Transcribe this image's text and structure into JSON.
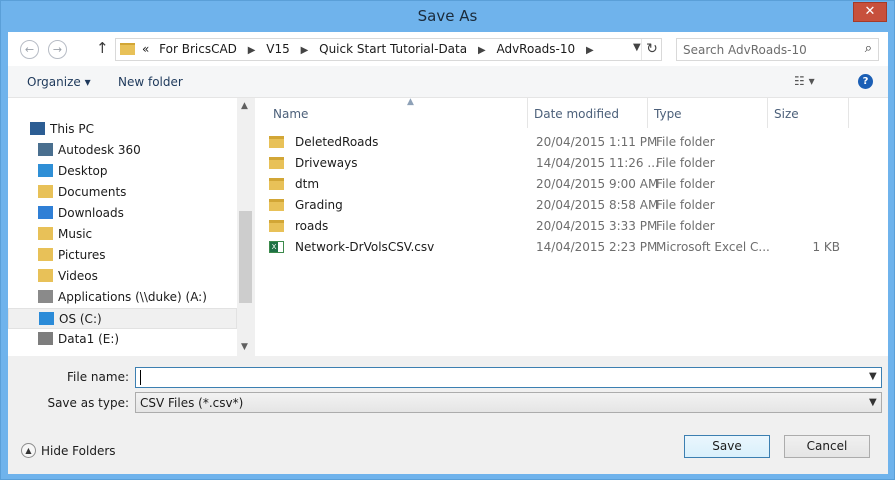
{
  "window": {
    "title": "Save As",
    "close_glyph": "✕"
  },
  "nav": {
    "back_glyph": "←",
    "forward_glyph": "→",
    "up_glyph": "↑",
    "address_prefix": "«",
    "crumbs": [
      "For BricsCAD",
      "V15",
      "Quick Start Tutorial-Data",
      "AdvRoads-10"
    ],
    "crumb_separator": "▶",
    "dropdown_glyph": "▼",
    "refresh_glyph": "↻",
    "search_placeholder": "Search AdvRoads-10",
    "search_glyph": "⌕"
  },
  "toolbar": {
    "organize_label": "Organize ▾",
    "new_folder_label": "New folder",
    "views_glyph": "☷ ▾",
    "help_glyph": "?"
  },
  "tree": [
    {
      "label": "This PC",
      "icon": "computer-icon",
      "color": "#2c5d93"
    },
    {
      "label": "Autodesk 360",
      "icon": "cloud-icon",
      "color": "#4a6f8f"
    },
    {
      "label": "Desktop",
      "icon": "desktop-folder-icon",
      "color": "#2f8fd6"
    },
    {
      "label": "Documents",
      "icon": "documents-folder-icon",
      "color": "#e8c158"
    },
    {
      "label": "Downloads",
      "icon": "downloads-folder-icon",
      "color": "#2f7fd6"
    },
    {
      "label": "Music",
      "icon": "music-folder-icon",
      "color": "#e8c158"
    },
    {
      "label": "Pictures",
      "icon": "pictures-folder-icon",
      "color": "#e8c158"
    },
    {
      "label": "Videos",
      "icon": "videos-folder-icon",
      "color": "#e8c158"
    },
    {
      "label": "Applications (\\\\duke) (A:)",
      "icon": "network-drive-icon",
      "color": "#8a8a8a"
    },
    {
      "label": "OS (C:)",
      "icon": "windows-drive-icon",
      "color": "#2b8bd8"
    },
    {
      "label": "Data1 (E:)",
      "icon": "drive-icon",
      "color": "#7d7d7d"
    }
  ],
  "columns": {
    "name": "Name",
    "date": "Date modified",
    "type": "Type",
    "size": "Size",
    "sort_glyph": "▲"
  },
  "files": [
    {
      "name": "DeletedRoads",
      "date": "20/04/2015 1:11 PM",
      "type": "File folder",
      "size": "",
      "icon": "folder-icon"
    },
    {
      "name": "Driveways",
      "date": "14/04/2015 11:26 ...",
      "type": "File folder",
      "size": "",
      "icon": "folder-icon"
    },
    {
      "name": "dtm",
      "date": "20/04/2015 9:00 AM",
      "type": "File folder",
      "size": "",
      "icon": "folder-icon"
    },
    {
      "name": "Grading",
      "date": "20/04/2015 8:58 AM",
      "type": "File folder",
      "size": "",
      "icon": "folder-icon"
    },
    {
      "name": "roads",
      "date": "20/04/2015 3:33 PM",
      "type": "File folder",
      "size": "",
      "icon": "folder-icon"
    },
    {
      "name": "Network-DrVolsCSV.csv",
      "date": "14/04/2015 2:23 PM",
      "type": "Microsoft Excel C...",
      "size": "1 KB",
      "icon": "excel-csv-icon"
    }
  ],
  "form": {
    "filename_label": "File name:",
    "filename_value": "",
    "savetype_label": "Save as type:",
    "savetype_value": "CSV Files (*.csv*)",
    "combo_glyph": "▼"
  },
  "footer": {
    "hide_folders_label": "Hide Folders",
    "hide_folders_glyph": "▲",
    "save_label": "Save",
    "cancel_label": "Cancel"
  }
}
